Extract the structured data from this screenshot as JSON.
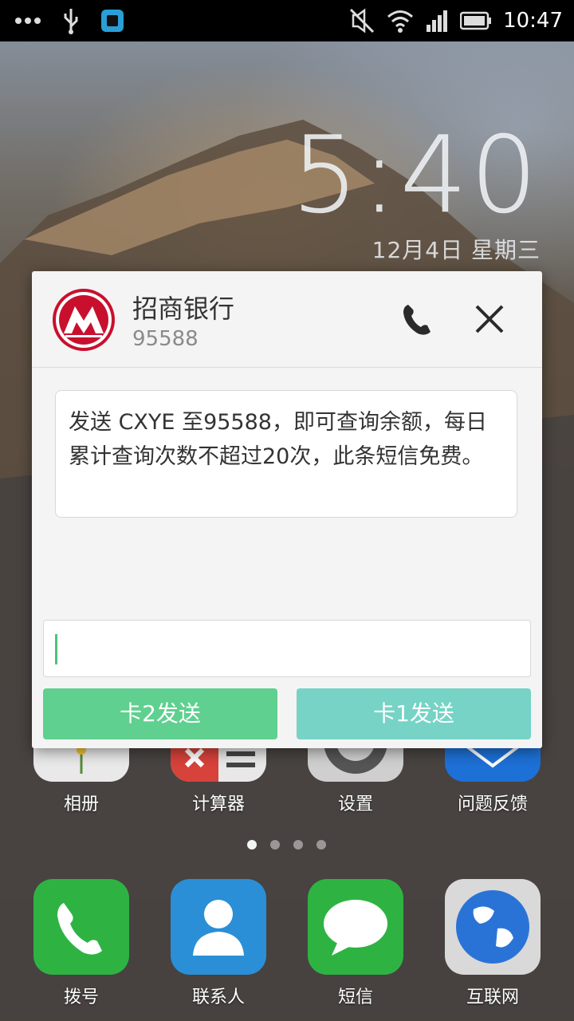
{
  "status_bar": {
    "time": "10:47",
    "icons": [
      "more-icon",
      "usb-icon",
      "app-notification-icon",
      "mute-icon",
      "wifi-icon",
      "signal-icon",
      "battery-icon"
    ]
  },
  "lock_clock": {
    "time": "5:40",
    "date": "12月4日 星期三"
  },
  "popup": {
    "sender_name": "招商银行",
    "sender_number": "95588",
    "message": "发送 CXYE 至95588，即可查询余额，每日累计查询次数不超过20次，此条短信免费。",
    "reply_placeholder": "",
    "send_card2_label": "卡2发送",
    "send_card1_label": "卡1发送",
    "colors": {
      "logo": "#c8102e",
      "send_card2": "#5fd08f",
      "send_card1": "#76d3c6"
    }
  },
  "apps_row": [
    {
      "label": "相册",
      "icon": "gallery-icon"
    },
    {
      "label": "计算器",
      "icon": "calculator-icon"
    },
    {
      "label": "设置",
      "icon": "settings-icon"
    },
    {
      "label": "问题反馈",
      "icon": "feedback-icon"
    }
  ],
  "page_indicator": {
    "pages": 4,
    "active": 1
  },
  "dock": [
    {
      "label": "拨号",
      "icon": "phone-icon"
    },
    {
      "label": "联系人",
      "icon": "contacts-icon"
    },
    {
      "label": "短信",
      "icon": "messages-icon"
    },
    {
      "label": "互联网",
      "icon": "browser-icon"
    }
  ]
}
